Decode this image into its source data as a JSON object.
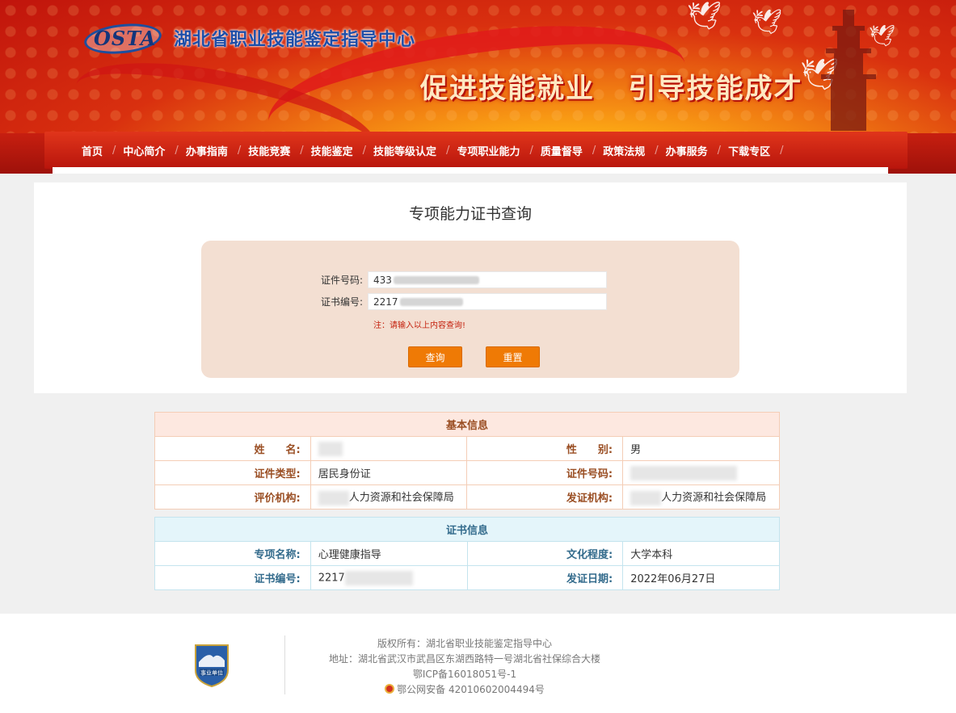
{
  "header": {
    "logo_text": "OSTA",
    "org_name": "湖北省职业技能鉴定指导中心",
    "slogan": "促进技能就业   引导技能成才"
  },
  "nav": {
    "items": [
      "首页",
      "中心简介",
      "办事指南",
      "技能竞赛",
      "技能鉴定",
      "技能等级认定",
      "专项职业能力",
      "质量督导",
      "政策法规",
      "办事服务",
      "下载专区"
    ]
  },
  "query": {
    "title": "专项能力证书查询",
    "id_label": "证件号码:",
    "id_value": "433",
    "cert_label": "证书编号:",
    "cert_value": "2217",
    "note": "注：请输入以上内容查询!",
    "search_button": "查询",
    "reset_button": "重置"
  },
  "basic_info": {
    "title": "基本信息",
    "name_label": "姓　　名:",
    "name_value": "",
    "gender_label": "性　　别:",
    "gender_value": "男",
    "id_type_label": "证件类型:",
    "id_type_value": "居民身份证",
    "id_no_label": "证件号码:",
    "id_no_value": "",
    "eval_org_label": "评价机构:",
    "eval_org_value": "人力资源和社会保障局",
    "issuer_label": "发证机构:",
    "issuer_value": "人力资源和社会保障局"
  },
  "cert_info": {
    "title": "证书信息",
    "specialty_label": "专项名称:",
    "specialty_value": "心理健康指导",
    "education_label": "文化程度:",
    "education_value": "大学本科",
    "cert_no_label": "证书编号:",
    "cert_no_value": "2217",
    "issue_date_label": "发证日期:",
    "issue_date_value": "2022年06月27日"
  },
  "footer": {
    "badge_text": "事业单位",
    "copyright": "版权所有：湖北省职业技能鉴定指导中心",
    "address": "地址：湖北省武汉市武昌区东湖西路特一号湖北省社保综合大楼",
    "icp": "鄂ICP备16018051号-1",
    "police": "鄂公网安备 42010602004494号"
  },
  "colors": {
    "accent": "#ef7a05",
    "nav_red": "#c71f10",
    "note_red": "#c4210e"
  }
}
